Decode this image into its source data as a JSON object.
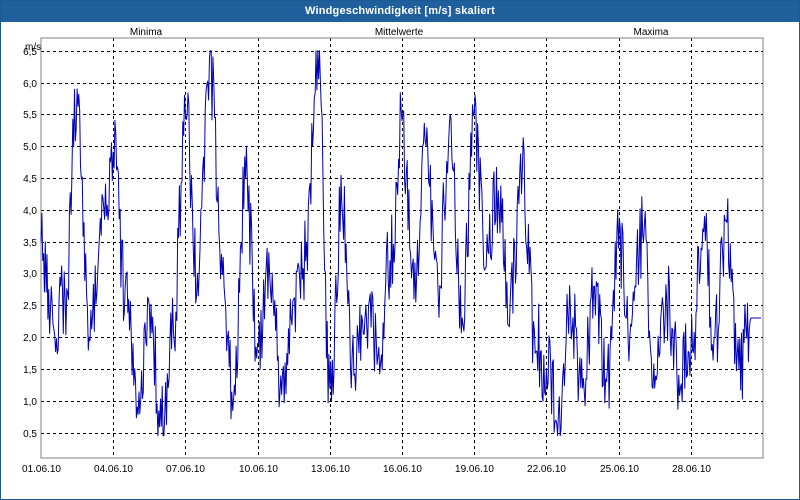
{
  "window": {
    "title": "Windgeschwindigkeit [m/s] skaliert"
  },
  "colors": {
    "title_bar": "#1f5f9c",
    "series_line": "#0000b4",
    "legend_min": "#1aa01a",
    "legend_mean": "#1a1ab4",
    "legend_max": "#b41a1a",
    "grid": "#000000"
  },
  "chart_data": {
    "type": "line",
    "title": "",
    "xlabel": "",
    "ylabel": "m/s",
    "ylim": [
      0.1,
      6.7
    ],
    "xlim": [
      "01.06.10",
      "01.07.10"
    ],
    "grid": true,
    "legend_placement": "top",
    "legend": [
      {
        "name": "Minima",
        "color": "#1aa01a"
      },
      {
        "name": "Mittelwerte",
        "color": "#1a1ab4"
      },
      {
        "name": "Maxima",
        "color": "#b41a1a"
      }
    ],
    "y_ticks": [
      "0,5",
      "1,0",
      "1,5",
      "2,0",
      "2,5",
      "3,0",
      "3,5",
      "4,0",
      "4,5",
      "5,0",
      "5,5",
      "6,0",
      "6,5"
    ],
    "x_ticks": [
      "01.06.10",
      "04.06.10",
      "07.06.10",
      "10.06.10",
      "13.06.10",
      "16.06.10",
      "19.06.10",
      "22.06.10",
      "25.06.10",
      "28.06.10"
    ],
    "series": [
      {
        "name": "Mittelwerte",
        "x": [
          "01.06.10",
          "01.06.10",
          "02.06.10",
          "02.06.10",
          "03.06.10",
          "03.06.10",
          "04.06.10",
          "04.06.10",
          "05.06.10",
          "05.06.10",
          "06.06.10",
          "06.06.10",
          "07.06.10",
          "07.06.10",
          "08.06.10",
          "08.06.10",
          "09.06.10",
          "09.06.10",
          "10.06.10",
          "10.06.10",
          "11.06.10",
          "11.06.10",
          "12.06.10",
          "12.06.10",
          "13.06.10",
          "13.06.10",
          "14.06.10",
          "14.06.10",
          "15.06.10",
          "15.06.10",
          "16.06.10",
          "16.06.10",
          "17.06.10",
          "17.06.10",
          "18.06.10",
          "18.06.10",
          "19.06.10",
          "19.06.10",
          "20.06.10",
          "20.06.10",
          "21.06.10",
          "21.06.10",
          "22.06.10",
          "22.06.10",
          "23.06.10",
          "23.06.10",
          "24.06.10",
          "24.06.10",
          "25.06.10",
          "25.06.10",
          "26.06.10",
          "26.06.10",
          "27.06.10",
          "27.06.10",
          "28.06.10",
          "28.06.10",
          "29.06.10",
          "29.06.10",
          "30.06.10",
          "30.06.10"
        ],
        "values": [
          3.5,
          2.2,
          2.6,
          5.9,
          2.0,
          3.6,
          4.9,
          2.8,
          0.9,
          2.5,
          0.6,
          2.1,
          5.5,
          3.0,
          6.4,
          3.3,
          1.0,
          4.5,
          1.9,
          3.0,
          1.1,
          2.6,
          3.2,
          6.5,
          1.2,
          4.1,
          1.4,
          2.5,
          1.7,
          3.2,
          5.4,
          2.6,
          5.0,
          2.7,
          5.5,
          2.3,
          5.5,
          3.1,
          4.3,
          2.6,
          4.6,
          2.1,
          1.5,
          0.8,
          2.4,
          1.2,
          2.8,
          1.3,
          3.4,
          2.2,
          3.6,
          1.2,
          2.6,
          1.4,
          1.7,
          3.7,
          2.0,
          3.8,
          1.5,
          2.3
        ]
      }
    ]
  }
}
